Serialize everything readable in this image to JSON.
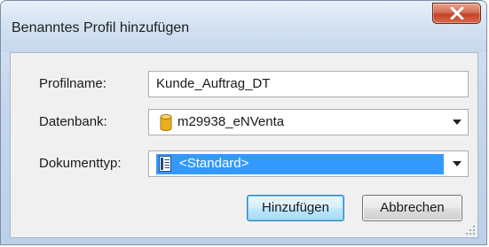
{
  "dialog": {
    "title": "Benanntes Profil hinzufügen",
    "close_label": "X"
  },
  "form": {
    "profilname": {
      "label": "Profilname:",
      "value": "Kunde_Auftrag_DT"
    },
    "datenbank": {
      "label": "Datenbank:",
      "value": "m29938_eNVenta",
      "icon": "database-icon"
    },
    "dokumenttyp": {
      "label": "Dokumenttyp:",
      "value": "<Standard>",
      "icon": "document-type-icon"
    }
  },
  "buttons": {
    "add_label": "Hinzufügen",
    "cancel_label": "Abbrechen"
  },
  "colors": {
    "selection": "#3399ff",
    "close_button": "#c2432a",
    "database_icon": "#e8b020"
  }
}
